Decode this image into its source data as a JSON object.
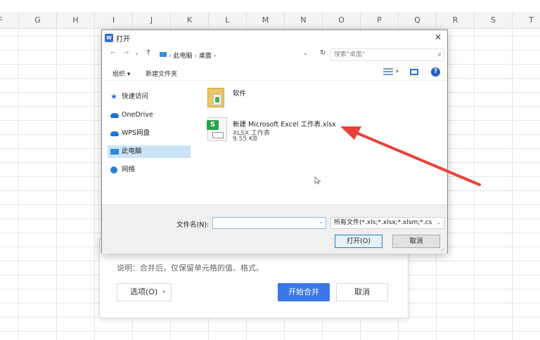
{
  "spreadsheet": {
    "columns": [
      "F",
      "G",
      "H",
      "I",
      "J",
      "K",
      "L",
      "M",
      "N",
      "O",
      "P",
      "Q",
      "R",
      "S",
      "T"
    ]
  },
  "merge_dialog": {
    "note": "说明：合并后，仅保留单元格的值、格式。",
    "options_label": "选项(O)",
    "start_label": "开始合并",
    "cancel_label": "取消",
    "accent": "#3b78e7"
  },
  "open_dialog": {
    "title": "打开",
    "breadcrumb": [
      "此电脑",
      "桌面"
    ],
    "search_placeholder": "搜索\"桌面\"",
    "toolbar": {
      "organize": "组织 ▾",
      "new_folder": "新建文件夹"
    },
    "nav_items": [
      {
        "label": "快速访问",
        "icon": "star-icon"
      },
      {
        "label": "OneDrive",
        "icon": "cloud-icon"
      },
      {
        "label": "WPS网盘",
        "icon": "wps-cloud-icon"
      },
      {
        "label": "此电脑",
        "icon": "computer-icon",
        "selected": true
      },
      {
        "label": "网络",
        "icon": "network-icon"
      }
    ],
    "files": [
      {
        "name": "软件",
        "kind": "folder"
      },
      {
        "name": "新建 Microsoft Excel 工作表.xlsx",
        "type": "XLSX 工作表",
        "size": "9.55 KB",
        "kind": "xlsx"
      }
    ],
    "filename_label": "文件名(N):",
    "filename_value": "",
    "filter_value": "所有文件(*.xls;*.xlsx;*.xlsm;*.cs",
    "open_label": "打开(O)",
    "cancel_label": "取消"
  },
  "annotation": {
    "arrow_color": "#e8413c"
  }
}
